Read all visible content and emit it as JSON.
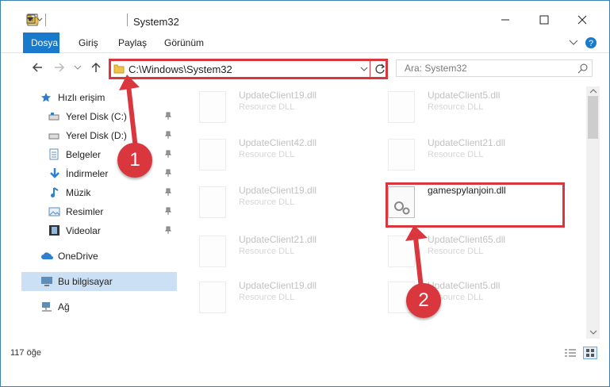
{
  "window": {
    "title": "System32"
  },
  "ribbon": {
    "tabs": [
      "Dosya",
      "Giriş",
      "Paylaş",
      "Görünüm"
    ]
  },
  "address": {
    "path": "C:\\Windows\\System32"
  },
  "search": {
    "placeholder": "Ara: System32"
  },
  "sidebar": {
    "quick_access": "Hızlı erişim",
    "items": [
      {
        "label": "Yerel Disk (C:)",
        "icon": "drive-icon"
      },
      {
        "label": "Yerel Disk (D:)",
        "icon": "drive-icon"
      },
      {
        "label": "Belgeler",
        "icon": "documents-icon"
      },
      {
        "label": "İndirmeler",
        "icon": "download-icon"
      },
      {
        "label": "Müzik",
        "icon": "music-icon"
      },
      {
        "label": "Resimler",
        "icon": "pictures-icon"
      },
      {
        "label": "Videolar",
        "icon": "videos-icon"
      }
    ],
    "onedrive": "OneDrive",
    "this_pc": "Bu bilgisayar",
    "network": "Ağ"
  },
  "files": [
    {
      "name": "UpdateClient19.dll",
      "type": "Resource DLL"
    },
    {
      "name": "UpdateClient5.dll",
      "type": "Resource DLL"
    },
    {
      "name": "UpdateClient42.dll",
      "type": "Resource DLL"
    },
    {
      "name": "UpdateClient21.dll",
      "type": "Resource DLL"
    },
    {
      "name": "UpdateClient19.dll",
      "type": "Resource DLL"
    },
    {
      "name": "gamespylanjoin.dll",
      "type": ""
    },
    {
      "name": "UpdateClient21.dll",
      "type": "Resource DLL"
    },
    {
      "name": "UpdateClient65.dll",
      "type": "Resource DLL"
    },
    {
      "name": "UpdateClient19.dll",
      "type": "Resource DLL"
    },
    {
      "name": "UpdateClient5.dll",
      "type": "Resource DLL"
    }
  ],
  "status": {
    "count": "117 öğe"
  },
  "annotations": {
    "step1": "1",
    "step2": "2",
    "color": "#d9363e"
  }
}
